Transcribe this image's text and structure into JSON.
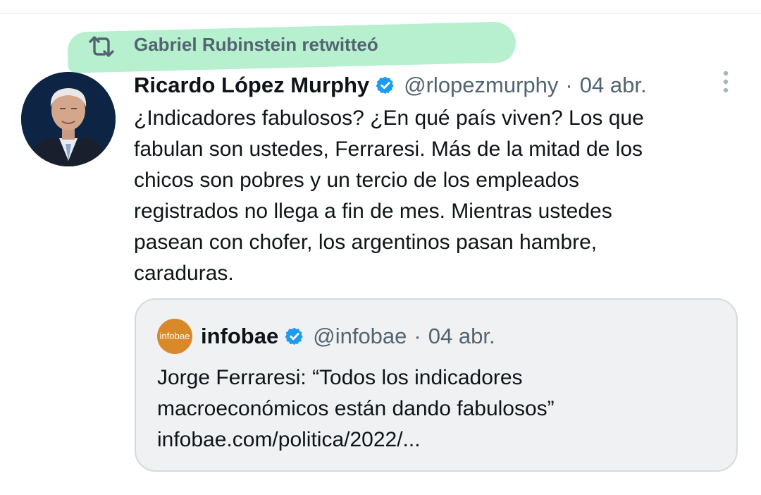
{
  "retweet": {
    "icon": "retweet-icon",
    "text": "Gabriel Rubinstein retwitteó",
    "highlight_color": "#b6f0cf"
  },
  "tweet": {
    "author_name": "Ricardo López Murphy",
    "verified_icon": "verified-badge-icon",
    "handle": "@rlopezmurphy",
    "separator": "·",
    "date": "04 abr.",
    "more_icon": "more-vertical-icon",
    "text_lines": [
      "¿Indicadores fabulosos? ¿En qué país viven? Los que",
      "fabulan son ustedes, Ferraresi. Más de la mitad de los",
      "chicos son pobres y un tercio de los empleados",
      "registrados no llega a fin de mes. Mientras ustedes",
      "pasean con chofer, los argentinos pasan hambre,",
      "caraduras."
    ]
  },
  "quote": {
    "avatar_text": "infobae",
    "author_name": "infobae",
    "handle": "@infobae",
    "separator": "·",
    "date": "04 abr.",
    "text_lines": [
      "Jorge Ferraresi: “Todos los indicadores",
      "macroeconómicos están dando fabulosos”",
      "infobae.com/politica/2022/..."
    ]
  },
  "colors": {
    "text_primary": "#0f1419",
    "text_secondary": "#536471",
    "verified_blue": "#1d9bf0",
    "quote_bg": "#eff1f3",
    "infobae_orange": "#d8892a"
  }
}
